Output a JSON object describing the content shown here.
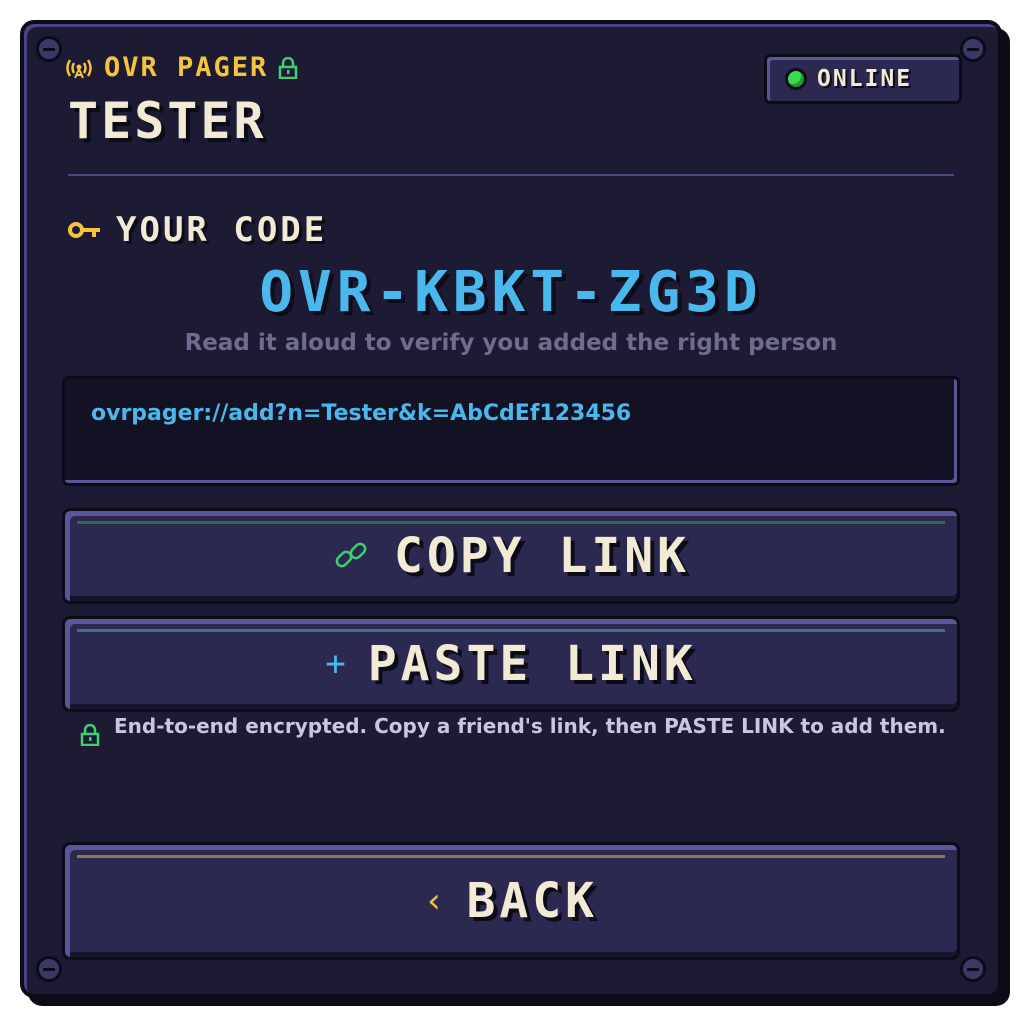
{
  "header": {
    "app_title": "OVR PAGER",
    "user_name": "TESTER",
    "status_label": "ONLINE",
    "antenna_icon": "(·A·)",
    "lock_icon": "🔒"
  },
  "code_section": {
    "label": "YOUR CODE",
    "key_icon": "⬛",
    "code": "OVR-KBKT-ZG3D",
    "hint": "Read it aloud to verify you added the right person"
  },
  "link": {
    "url": "ovrpager://add?n=Tester&k=AbCdEf123456"
  },
  "buttons": {
    "copy": {
      "label": "COPY LINK",
      "icon": "∞"
    },
    "paste": {
      "label": "PASTE LINK",
      "icon": "+"
    },
    "back": {
      "label": "BACK",
      "icon": "‹"
    }
  },
  "footer": {
    "text": "End-to-end encrypted. Copy a friend's link, then PASTE LINK to add them."
  },
  "colors": {
    "background": "#1c1b33",
    "accent_yellow": "#f6c43a",
    "accent_blue": "#4ab8ec",
    "accent_green": "#3bd952",
    "text_cream": "#f3ead5"
  }
}
